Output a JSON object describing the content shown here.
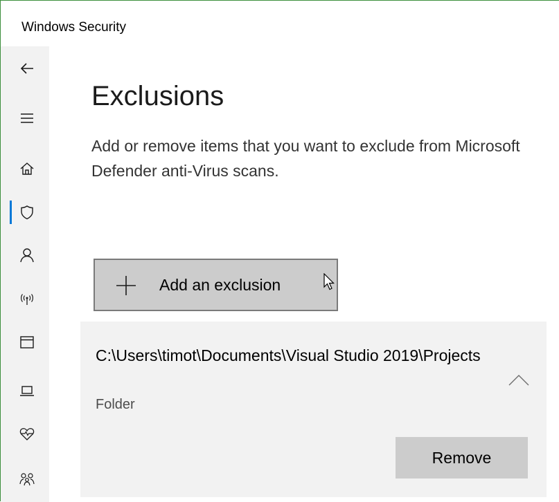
{
  "window": {
    "title": "Windows Security"
  },
  "nav": {
    "items": [
      {
        "name": "back",
        "icon": "back-arrow-icon"
      },
      {
        "name": "menu",
        "icon": "hamburger-menu-icon"
      },
      {
        "name": "home",
        "icon": "home-icon"
      },
      {
        "name": "virus-threat-protection",
        "icon": "shield-icon",
        "selected": true
      },
      {
        "name": "account-protection",
        "icon": "person-icon"
      },
      {
        "name": "firewall-network-protection",
        "icon": "wifi-antenna-icon"
      },
      {
        "name": "app-browser-control",
        "icon": "app-window-icon"
      },
      {
        "name": "device-security",
        "icon": "laptop-icon"
      },
      {
        "name": "device-performance-health",
        "icon": "heart-pulse-icon"
      },
      {
        "name": "family-options",
        "icon": "family-icon"
      }
    ],
    "accent_color": "#0078d7"
  },
  "page": {
    "title": "Exclusions",
    "description": "Add or remove items that you want to exclude from Microsoft Defender anti-Virus scans."
  },
  "add_button": {
    "icon": "plus-icon",
    "label": "Add an exclusion"
  },
  "exclusions": [
    {
      "path": "C:\\Users\\timot\\Documents\\Visual Studio 2019\\Projects",
      "type": "Folder",
      "expanded": true,
      "remove_label": "Remove"
    }
  ]
}
